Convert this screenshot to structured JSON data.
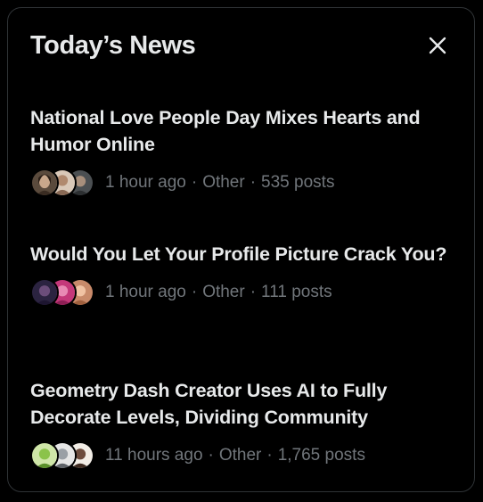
{
  "header": {
    "title": "Today’s News",
    "close_icon": "close-icon"
  },
  "colors": {
    "background": "#000000",
    "border": "#2f3336",
    "primary_text": "#e7e9ea",
    "secondary_text": "#71767b"
  },
  "stories": [
    {
      "title": "National Love People Day Mixes Hearts and Humor Online",
      "time": "1 hour ago",
      "category": "Other",
      "posts": "535 posts"
    },
    {
      "title": "Would You Let Your Profile Picture Crack You?",
      "time": "1 hour ago",
      "category": "Other",
      "posts": "111 posts"
    },
    {
      "title": "Geometry Dash Creator Uses AI to Fully Decorate Levels, Dividing Community",
      "time": "11 hours ago",
      "category": "Other",
      "posts": "1,765 posts"
    }
  ],
  "separator": "·"
}
